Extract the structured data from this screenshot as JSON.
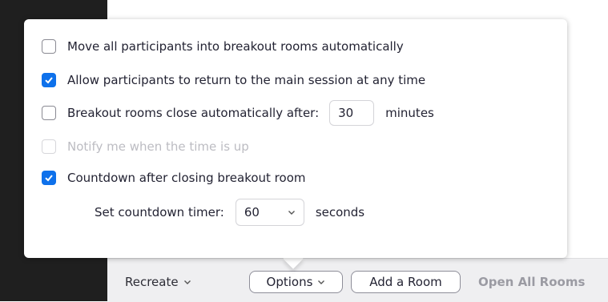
{
  "options": {
    "move_all": {
      "label": "Move all participants into breakout rooms automatically",
      "checked": false
    },
    "allow_return": {
      "label": "Allow participants to return to the main session at any time",
      "checked": true
    },
    "auto_close": {
      "label": "Breakout rooms close automatically after:",
      "checked": false,
      "minutes_value": "30",
      "minutes_unit": "minutes"
    },
    "notify": {
      "label": "Notify me when the time is up",
      "checked": false,
      "disabled": true
    },
    "countdown": {
      "label": "Countdown after closing breakout room",
      "checked": true
    },
    "countdown_timer": {
      "label": "Set countdown timer:",
      "value": "60",
      "unit": "seconds"
    }
  },
  "bottom_bar": {
    "recreate": "Recreate",
    "options": "Options",
    "add_room": "Add a Room",
    "open_all": "Open All Rooms"
  },
  "colors": {
    "accent": "#0e71eb",
    "disabled": "#bcbcc2"
  }
}
